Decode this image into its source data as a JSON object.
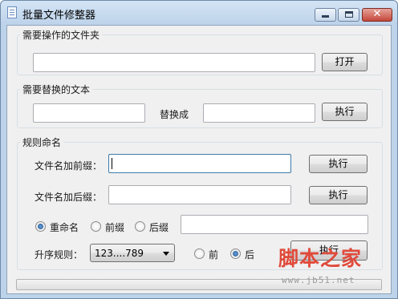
{
  "window": {
    "title": "批量文件修整器",
    "icon": "document-icon",
    "controls": {
      "minimize": "minimize-icon",
      "maximize": "maximize-icon",
      "close_glyph": "✕"
    }
  },
  "folder_group": {
    "title": "需要操作的文件夹",
    "path_value": "",
    "open_button": "打开"
  },
  "replace_group": {
    "title": "需要替换的文本",
    "find_value": "",
    "replace_with_label": "替换成",
    "replace_value": "",
    "execute_button": "执行"
  },
  "rename_group": {
    "title": "规则命名",
    "prefix_label": "文件名加前缀：",
    "prefix_value": "",
    "prefix_execute": "执行",
    "suffix_label": "文件名加后缀：",
    "suffix_value": "",
    "suffix_execute": "执行",
    "mode_options": [
      {
        "label": "重命名",
        "selected": true
      },
      {
        "label": "前缀",
        "selected": false
      },
      {
        "label": "后缀",
        "selected": false
      }
    ],
    "rename_value": "",
    "order_label": "升序规则：",
    "order_selected": "123....789",
    "position_options": [
      {
        "label": "前",
        "selected": false
      },
      {
        "label": "后",
        "selected": true
      }
    ],
    "main_execute": "执行"
  },
  "progress": {
    "fraction": 0.0
  },
  "watermark": {
    "text": "脚本之家",
    "url": "www.jb51.net"
  },
  "colors": {
    "accent": "#3d7bad",
    "close": "#c5473a",
    "watermark": "#e04a3a",
    "progress": "#37b721"
  }
}
